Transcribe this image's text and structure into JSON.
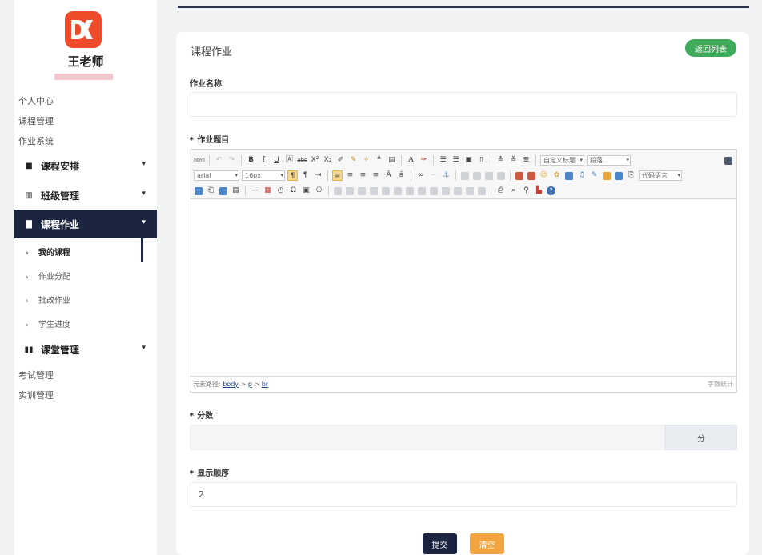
{
  "sidebar": {
    "teacher_name": "王老师",
    "top_links": [
      "个人中心",
      "课程管理",
      "作业系统"
    ],
    "groups": {
      "schedule": "课程安排",
      "class_mgmt": "班级管理",
      "homework": "课程作业",
      "classroom": "课堂管理"
    },
    "homework_subitems": [
      "我的课程",
      "作业分配",
      "批改作业",
      "学生进度"
    ],
    "bottom_links": [
      "考试管理",
      "实训管理"
    ],
    "accent_color": "#1c2540"
  },
  "card": {
    "title": "课程作业",
    "back_button": "返回列表"
  },
  "form": {
    "name_label": "作业名称",
    "name_value": "",
    "topic_label": "作业题目",
    "required_mark": "*",
    "score_label": "分数",
    "score_value": "",
    "score_unit": "分",
    "order_label": "显示顺序",
    "order_value": "2",
    "submit_label": "提交",
    "clear_label": "清空"
  },
  "editor": {
    "font_family": "arial",
    "font_size": "16px",
    "custom_heading": "自定义标题",
    "paragraph": "段落",
    "code_language": "代码语言",
    "path_label": "元素路径:",
    "path": [
      "body",
      "p",
      "br"
    ],
    "path_sep": ">",
    "word_count": "字数统计",
    "html_btn": "html",
    "bold": "B",
    "italic": "I",
    "underline": "U",
    "superscript": "X²",
    "subscript": "X₂",
    "quote": "❝",
    "font_color": "A",
    "omega": "Ω",
    "help": "?"
  }
}
